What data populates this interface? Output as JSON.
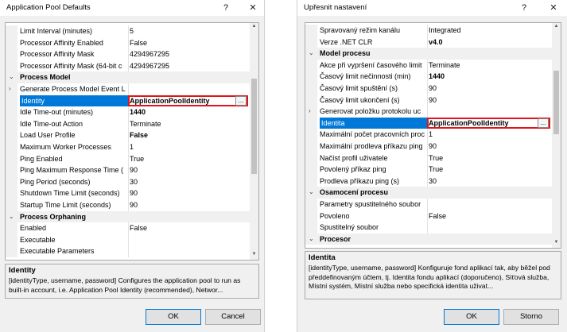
{
  "left": {
    "title": "Application Pool Defaults",
    "help_glyph": "?",
    "close_glyph": "✕",
    "rows": [
      {
        "type": "prop",
        "name": "Limit Interval (minutes)",
        "value": "5"
      },
      {
        "type": "prop",
        "name": "Processor Affinity Enabled",
        "value": "False"
      },
      {
        "type": "prop",
        "name": "Processor Affinity Mask",
        "value": "4294967295"
      },
      {
        "type": "prop",
        "name": "Processor Affinity Mask (64-bit c",
        "value": "4294967295"
      },
      {
        "type": "cat",
        "name": "Process Model",
        "expander": "⌄"
      },
      {
        "type": "prop",
        "name": "Generate Process Model Event L",
        "value": "",
        "expander": "›"
      },
      {
        "type": "sel",
        "name": "Identity",
        "value": "ApplicationPoolIdentity",
        "bold": true,
        "dots": "..."
      },
      {
        "type": "prop",
        "name": "Idle Time-out (minutes)",
        "value": "1440",
        "bold": true
      },
      {
        "type": "prop",
        "name": "Idle Time-out Action",
        "value": "Terminate"
      },
      {
        "type": "prop",
        "name": "Load User Profile",
        "value": "False",
        "bold": true
      },
      {
        "type": "prop",
        "name": "Maximum Worker Processes",
        "value": "1"
      },
      {
        "type": "prop",
        "name": "Ping Enabled",
        "value": "True"
      },
      {
        "type": "prop",
        "name": "Ping Maximum Response Time (",
        "value": "90"
      },
      {
        "type": "prop",
        "name": "Ping Period (seconds)",
        "value": "30"
      },
      {
        "type": "prop",
        "name": "Shutdown Time Limit (seconds)",
        "value": "90"
      },
      {
        "type": "prop",
        "name": "Startup Time Limit (seconds)",
        "value": "90"
      },
      {
        "type": "cat",
        "name": "Process Orphaning",
        "expander": "⌄"
      },
      {
        "type": "prop",
        "name": "Enabled",
        "value": "False"
      },
      {
        "type": "prop",
        "name": "Executable",
        "value": ""
      },
      {
        "type": "prop",
        "name": "Executable Parameters",
        "value": ""
      }
    ],
    "desc_title": "Identity",
    "desc_text": "[identityType, username, password] Configures the application pool to run as built-in account, i.e. Application Pool Identity (recommended), Networ...",
    "ok_label": "OK",
    "cancel_label": "Cancel"
  },
  "right": {
    "title": "Upřesnit nastavení",
    "help_glyph": "?",
    "close_glyph": "✕",
    "rows": [
      {
        "type": "prop",
        "name": "Spravovaný režim kanálu",
        "value": "Integrated"
      },
      {
        "type": "prop",
        "name": "Verze .NET CLR",
        "value": "v4.0",
        "bold": true
      },
      {
        "type": "cat",
        "name": "Model procesu",
        "expander": "⌄"
      },
      {
        "type": "prop",
        "name": "Akce při vypršení časového limit",
        "value": "Terminate"
      },
      {
        "type": "prop",
        "name": "Časový limit nečinnosti (min)",
        "value": "1440",
        "bold": true
      },
      {
        "type": "prop",
        "name": "Časový limit spuštění (s)",
        "value": "90"
      },
      {
        "type": "prop",
        "name": "Časový limit ukončení (s)",
        "value": "90"
      },
      {
        "type": "prop",
        "name": "Generovat položku protokolu uc",
        "value": "",
        "expander": "›"
      },
      {
        "type": "sel",
        "name": "Identita",
        "value": "ApplicationPoolIdentity",
        "bold": true,
        "dots": "..."
      },
      {
        "type": "prop",
        "name": "Maximální počet pracovních proc",
        "value": "1"
      },
      {
        "type": "prop",
        "name": "Maximální prodleva příkazu ping",
        "value": "90"
      },
      {
        "type": "prop",
        "name": "Načíst profil uživatele",
        "value": "True"
      },
      {
        "type": "prop",
        "name": "Povolený příkaz ping",
        "value": "True"
      },
      {
        "type": "prop",
        "name": "Prodleva příkazu ping (s)",
        "value": "30"
      },
      {
        "type": "cat",
        "name": "Osamocení procesu",
        "expander": "⌄"
      },
      {
        "type": "prop",
        "name": "Parametry spustitelného soubor",
        "value": ""
      },
      {
        "type": "prop",
        "name": "Povoleno",
        "value": "False"
      },
      {
        "type": "prop",
        "name": "Spustitelný soubor",
        "value": ""
      },
      {
        "type": "cat",
        "name": "Procesor",
        "expander": "⌄"
      }
    ],
    "desc_title": "Identita",
    "desc_text": "[identityType, username, password] Konfiguruje fond aplikací tak, aby běžel pod předdefinovaným účtem, tj. Identita fondu aplikací (doporučeno), Síťová služba, Místní systém, Místní služba nebo specifická identita uživat...",
    "ok_label": "OK",
    "cancel_label": "Storno"
  }
}
